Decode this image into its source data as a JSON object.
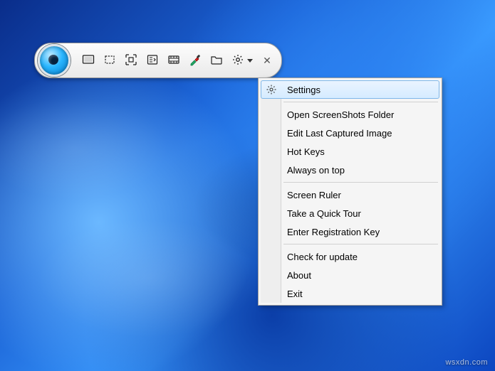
{
  "watermark": "wsxdn.com",
  "toolbar": {
    "buttons": [
      {
        "name": "capture-fullscreen-icon"
      },
      {
        "name": "capture-region-icon"
      },
      {
        "name": "capture-window-icon"
      },
      {
        "name": "capture-scrolling-icon"
      },
      {
        "name": "capture-video-icon"
      },
      {
        "name": "color-picker-icon"
      },
      {
        "name": "open-folder-icon"
      },
      {
        "name": "settings-gear-icon"
      }
    ]
  },
  "menu": {
    "groups": [
      [
        {
          "label": "Settings",
          "icon": "gear-icon",
          "selected": true
        }
      ],
      [
        {
          "label": "Open ScreenShots Folder"
        },
        {
          "label": "Edit Last Captured Image"
        },
        {
          "label": "Hot Keys"
        },
        {
          "label": "Always on top"
        }
      ],
      [
        {
          "label": "Screen Ruler"
        },
        {
          "label": "Take a Quick Tour"
        },
        {
          "label": "Enter Registration Key"
        }
      ],
      [
        {
          "label": "Check for update"
        },
        {
          "label": "About"
        },
        {
          "label": "Exit"
        }
      ]
    ]
  }
}
